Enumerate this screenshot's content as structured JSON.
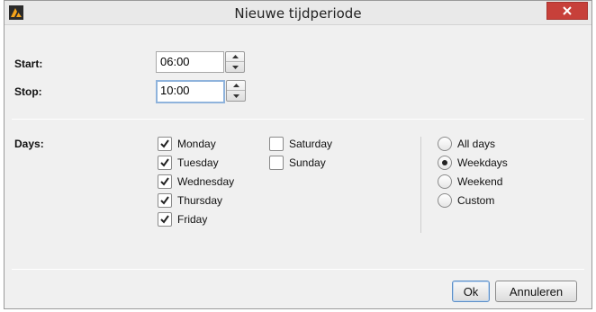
{
  "window": {
    "title": "Nieuwe tijdperiode"
  },
  "icons": {
    "app": "app-logo-icon",
    "close": "close-icon"
  },
  "colors": {
    "close_button": "#c7403a",
    "focus_border": "#8fb3dc"
  },
  "form": {
    "start_label": "Start:",
    "start_value": "06:00",
    "stop_label": "Stop:",
    "stop_value": "10:00",
    "days_label": "Days:"
  },
  "days": [
    {
      "label": "Monday",
      "checked": true
    },
    {
      "label": "Tuesday",
      "checked": true
    },
    {
      "label": "Wednesday",
      "checked": true
    },
    {
      "label": "Thursday",
      "checked": true
    },
    {
      "label": "Friday",
      "checked": true
    },
    {
      "label": "Saturday",
      "checked": false
    },
    {
      "label": "Sunday",
      "checked": false
    }
  ],
  "presets": [
    {
      "label": "All days",
      "selected": false
    },
    {
      "label": "Weekdays",
      "selected": true
    },
    {
      "label": "Weekend",
      "selected": false
    },
    {
      "label": "Custom",
      "selected": false
    }
  ],
  "buttons": {
    "ok": "Ok",
    "cancel": "Annuleren"
  }
}
